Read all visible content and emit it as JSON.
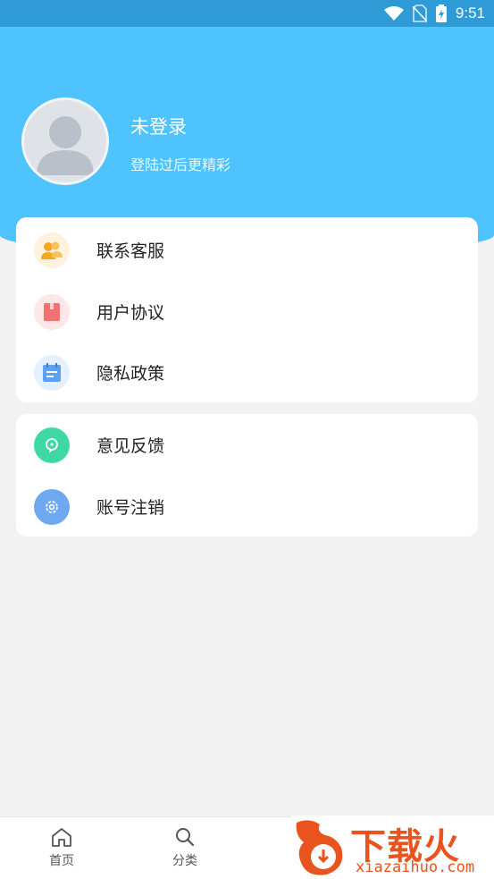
{
  "status_bar": {
    "time": "9:51"
  },
  "profile": {
    "name": "未登录",
    "subtitle": "登陆过后更精彩"
  },
  "menu_group_1": [
    {
      "label": "联系客服",
      "icon": "customer-service-icon"
    },
    {
      "label": "用户协议",
      "icon": "user-agreement-icon"
    },
    {
      "label": "隐私政策",
      "icon": "privacy-policy-icon"
    }
  ],
  "menu_group_2": [
    {
      "label": "意见反馈",
      "icon": "feedback-icon"
    },
    {
      "label": "账号注销",
      "icon": "account-cancel-icon"
    }
  ],
  "bottom_nav": [
    {
      "label": "首页",
      "icon": "home-icon"
    },
    {
      "label": "分类",
      "icon": "search-icon"
    }
  ],
  "watermark": {
    "text": "下载火",
    "url": "xiazaihuo.com"
  },
  "colors": {
    "header": "#4ec3fd",
    "status_bar": "#2e9bd6",
    "watermark": "#e9531d"
  }
}
